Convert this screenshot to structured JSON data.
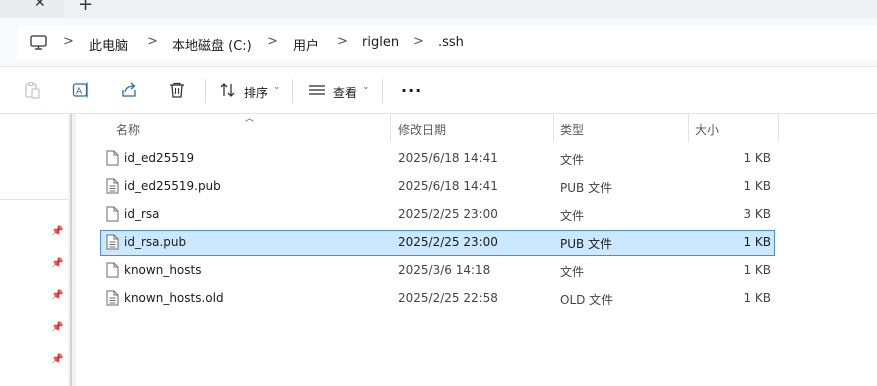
{
  "tabstrip": {
    "close_glyph": "✕",
    "new_tab_glyph": "+"
  },
  "breadcrumb": {
    "items": [
      "此电脑",
      "本地磁盘 (C:)",
      "用户",
      "riglen",
      ".ssh"
    ],
    "separator": ">"
  },
  "toolbar": {
    "sort_label": "排序",
    "view_label": "查看",
    "more_label": "···"
  },
  "columns": {
    "name": "名称",
    "modified": "修改日期",
    "type": "类型",
    "size": "大小"
  },
  "files": [
    {
      "name": "id_ed25519",
      "modified": "2025/6/18 14:41",
      "type": "文件",
      "size": "1 KB",
      "selected": false
    },
    {
      "name": "id_ed25519.pub",
      "modified": "2025/6/18 14:41",
      "type": "PUB 文件",
      "size": "1 KB",
      "selected": false
    },
    {
      "name": "id_rsa",
      "modified": "2025/2/25 23:00",
      "type": "文件",
      "size": "3 KB",
      "selected": false
    },
    {
      "name": "id_rsa.pub",
      "modified": "2025/2/25 23:00",
      "type": "PUB 文件",
      "size": "1 KB",
      "selected": true
    },
    {
      "name": "known_hosts",
      "modified": "2025/3/6 14:18",
      "type": "文件",
      "size": "1 KB",
      "selected": false
    },
    {
      "name": "known_hosts.old",
      "modified": "2025/2/25 22:58",
      "type": "OLD 文件",
      "size": "1 KB",
      "selected": false
    }
  ],
  "colors": {
    "selection_bg": "#cce8ff",
    "selection_border": "#4e8dd6",
    "icon_blue": "#2b6cb0"
  }
}
